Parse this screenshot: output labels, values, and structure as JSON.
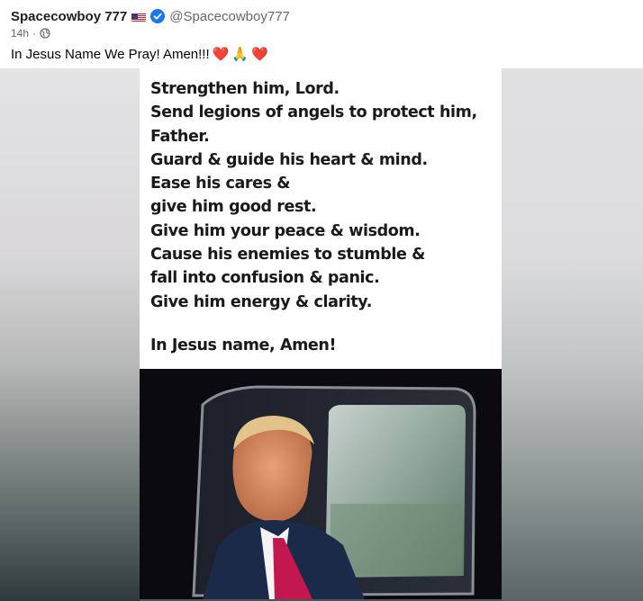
{
  "post": {
    "author_name": "Spacecowboy 777",
    "author_flag_icon": "us-flag-icon",
    "verified_icon": "verified-badge-icon",
    "handle": "@Spacecowboy777",
    "timestamp": "14h",
    "separator": "·",
    "visibility_icon": "globe-icon",
    "text": "In Jesus Name We Pray! Amen!!!",
    "emojis": [
      "❤️",
      "🙏",
      "❤️"
    ]
  },
  "meme": {
    "lines": [
      "Strengthen him, Lord.",
      "Send legions of angels to protect him,",
      "Father.",
      "Guard & guide his heart & mind.",
      "Ease his cares &",
      "give him good rest.",
      "Give him your peace & wisdom.",
      "Cause his enemies to stumble &",
      "fall into confusion & panic.",
      "Give him energy & clarity."
    ],
    "closing": "In Jesus name, Amen!"
  },
  "colors": {
    "name": "#1c1e21",
    "secondary": "#65676b",
    "verified": "#1877f2",
    "heart": "#e0245e"
  }
}
